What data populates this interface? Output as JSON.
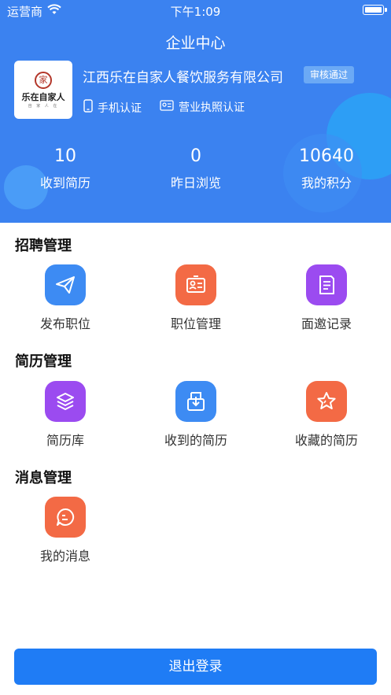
{
  "status_bar": {
    "carrier": "运营商",
    "time": "下午1:09"
  },
  "page": {
    "title": "企业中心"
  },
  "company": {
    "logo_text": "乐在自家人",
    "logo_seal": "家",
    "logo_sub": "自 家 人 在",
    "name": "江西乐在自家人餐饮服务有限公司",
    "audit_status": "审核通过",
    "auth_phone": "手机认证",
    "auth_license": "营业执照认证"
  },
  "stats": [
    {
      "value": "10",
      "label": "收到简历"
    },
    {
      "value": "0",
      "label": "昨日浏览"
    },
    {
      "value": "10640",
      "label": "我的积分"
    }
  ],
  "sections": {
    "recruit": {
      "title": "招聘管理",
      "items": [
        {
          "label": "发布职位",
          "icon": "paper-plane-icon"
        },
        {
          "label": "职位管理",
          "icon": "id-card-icon"
        },
        {
          "label": "面邀记录",
          "icon": "document-icon"
        }
      ]
    },
    "resume": {
      "title": "简历管理",
      "items": [
        {
          "label": "简历库",
          "icon": "layers-icon"
        },
        {
          "label": "收到的简历",
          "icon": "inbox-download-icon"
        },
        {
          "label": "收藏的简历",
          "icon": "star-icon"
        }
      ]
    },
    "message": {
      "title": "消息管理",
      "items": [
        {
          "label": "我的消息",
          "icon": "chat-bubble-icon"
        }
      ]
    }
  },
  "logout_label": "退出登录",
  "colors": {
    "header": "#3b82f0",
    "blue": "#3d8bf3",
    "orange": "#f36a45",
    "purple": "#9b4bf0",
    "button": "#1f7cf5"
  }
}
